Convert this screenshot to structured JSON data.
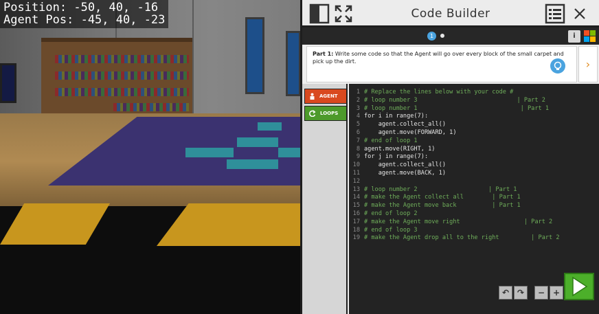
{
  "hud": {
    "position": "Position: -50, 40, -16",
    "agent_pos": "Agent Pos: -45, 40, -23"
  },
  "code_builder": {
    "title": "Code Builder",
    "page_dot": "1",
    "info_label": "i",
    "instruction_part": "Part 1:",
    "instruction_text": " Write some code so that the Agent will go over every block of the small carpet and pick up the dirt.",
    "next_label": "›",
    "categories": [
      {
        "label": "AGENT",
        "icon": "agent-icon"
      },
      {
        "label": "LOOPS",
        "icon": "loop-icon"
      }
    ],
    "code_lines": [
      {
        "n": "1",
        "text": "# Replace the lines below with your code #",
        "kind": "comment"
      },
      {
        "n": "2",
        "text": "# loop number 3                            | Part 2",
        "kind": "comment"
      },
      {
        "n": "3",
        "text": "# loop number 1                             | Part 1",
        "kind": "comment"
      },
      {
        "n": "4",
        "text": "for i in range(7):",
        "kind": "code"
      },
      {
        "n": "5",
        "text": "    agent.collect_all()",
        "kind": "code"
      },
      {
        "n": "6",
        "text": "    agent.move(FORWARD, 1)",
        "kind": "code"
      },
      {
        "n": "7",
        "text": "# end of loop 1",
        "kind": "comment"
      },
      {
        "n": "8",
        "text": "agent.move(RIGHT, 1)",
        "kind": "code"
      },
      {
        "n": "9",
        "text": "for j in range(7):",
        "kind": "code"
      },
      {
        "n": "10",
        "text": "    agent.collect_all()",
        "kind": "code"
      },
      {
        "n": "11",
        "text": "    agent.move(BACK, 1)",
        "kind": "code"
      },
      {
        "n": "12",
        "text": "",
        "kind": "code"
      },
      {
        "n": "13",
        "text": "# loop number 2                    | Part 1",
        "kind": "comment"
      },
      {
        "n": "14",
        "text": "# make the Agent collect all        | Part 1",
        "kind": "comment"
      },
      {
        "n": "15",
        "text": "# make the Agent move back          | Part 1",
        "kind": "comment"
      },
      {
        "n": "16",
        "text": "# end of loop 2",
        "kind": "comment"
      },
      {
        "n": "17",
        "text": "# make the Agent move right                  | Part 2",
        "kind": "comment"
      },
      {
        "n": "18",
        "text": "# end of loop 3",
        "kind": "comment"
      },
      {
        "n": "19",
        "text": "# make the Agent drop all to the right         | Part 2",
        "kind": "comment"
      }
    ],
    "tools": [
      {
        "name": "undo-button",
        "icon": "↶"
      },
      {
        "name": "redo-button",
        "icon": "↷"
      },
      {
        "name": "zoom-out-button",
        "icon": "−"
      },
      {
        "name": "zoom-in-button",
        "icon": "+"
      }
    ],
    "colors": {
      "comment": "#6fae5a",
      "code": "#e6e6e6",
      "agent": "#d9491f",
      "loops": "#4d9a2b",
      "run": "#4caf2a",
      "accent": "#4aa3df"
    }
  }
}
